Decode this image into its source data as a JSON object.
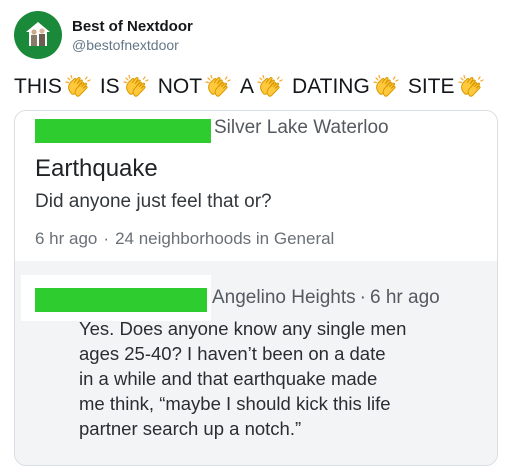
{
  "tweet": {
    "author": {
      "name": "Best of Nextdoor",
      "handle": "@bestofnextdoor",
      "avatar_icon": "nextdoor-house-icon",
      "avatar_color": "#1a8a3a"
    },
    "text_words": [
      "THIS",
      "IS",
      "NOT",
      "A",
      "DATING",
      "SITE"
    ],
    "separator_icon": "clapping-hands-emoji"
  },
  "card": {
    "post": {
      "author_redacted_color": "#2ecc2e",
      "neighborhood": "Silver Lake Waterloo",
      "title": "Earthquake",
      "body": "Did anyone just feel that or?",
      "time": "6 hr ago",
      "dot": "·",
      "audience": "24 neighborhoods in General"
    },
    "reply": {
      "author_redacted_color": "#2ecc2e",
      "neighborhood": "Angelino Heights",
      "dot": "·",
      "time": "6 hr ago",
      "body_lines": [
        "Yes. Does anyone know any single men",
        "ages 25-40? I haven’t been on a date",
        "in a while and that earthquake made",
        "me think, “maybe I should kick this life",
        "partner search up a notch.”"
      ]
    }
  }
}
